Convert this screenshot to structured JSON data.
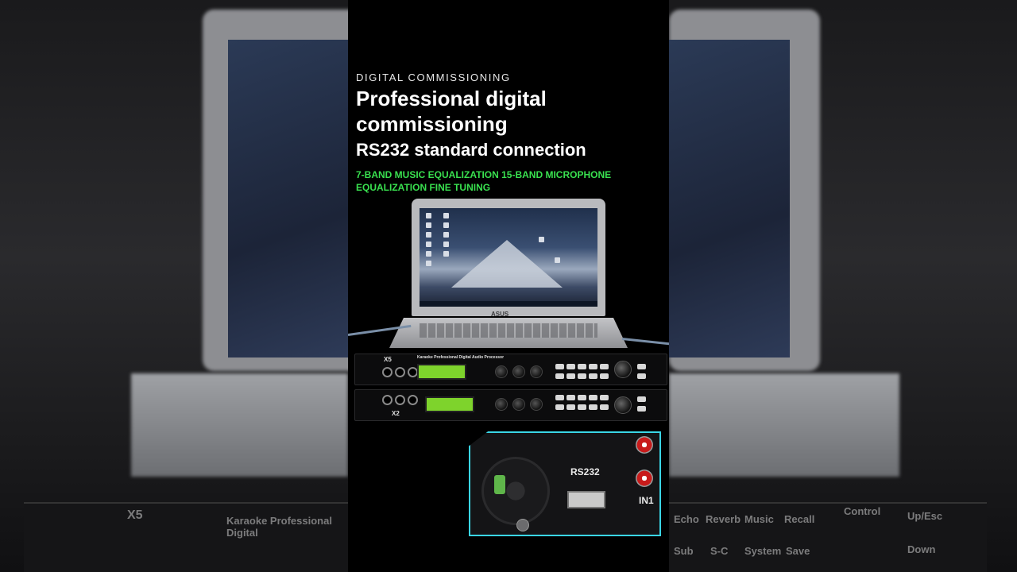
{
  "text": {
    "kicker": "DIGITAL COMMISSIONING",
    "headline": "Professional digital commissioning",
    "subheadline": "RS232 standard connection",
    "feature_line": "7-BAND MUSIC EQUALIZATION 15-BAND MICROPHONE EQUALIZATION FINE TUNING"
  },
  "laptop": {
    "brand": "ASUS"
  },
  "devices": {
    "unit_top_model": "X5",
    "unit_top_title": "Karaoke Professional Digital Audio Processor",
    "unit_bottom_model": "X2"
  },
  "inset": {
    "port_label": "RS232",
    "input_label": "IN1"
  },
  "background_labels": {
    "model": "X5",
    "title": "Karaoke Professional Digital",
    "buttons": [
      "Echo",
      "Reverb",
      "Music",
      "Recall",
      "Sub",
      "S-C",
      "System",
      "Save"
    ],
    "control": "Control",
    "up_esc": "Up/Esc",
    "down": "Down"
  },
  "colors": {
    "feature_text": "#39e04f",
    "inset_border": "#3ad6e6",
    "lcd": "#7ed32c"
  }
}
